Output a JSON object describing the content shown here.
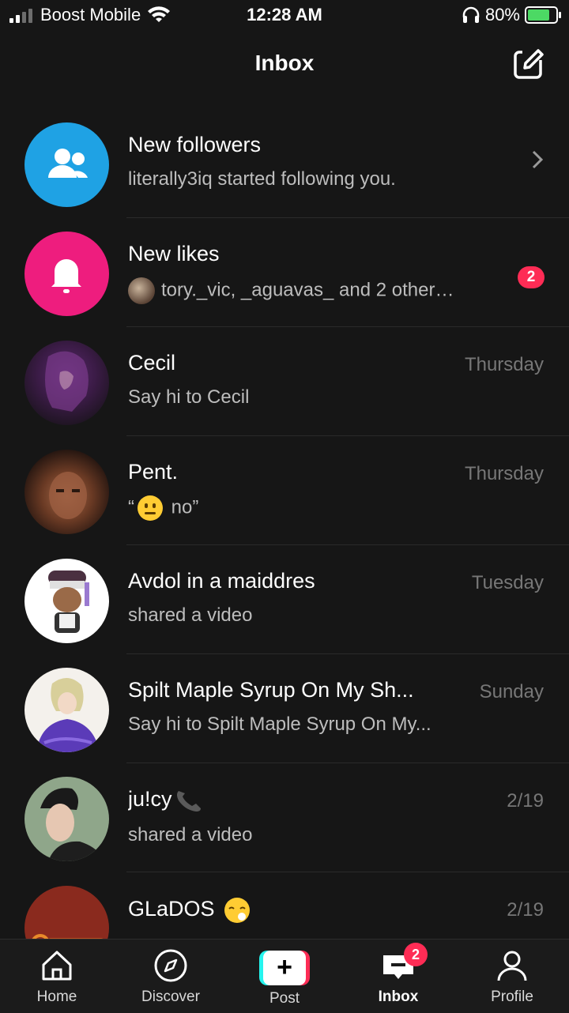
{
  "status_bar": {
    "carrier": "Boost Mobile",
    "time": "12:28 AM",
    "battery_percent": "80%",
    "battery_level": 0.8,
    "battery_color": "#4cd964"
  },
  "header": {
    "title": "Inbox",
    "compose_icon": "compose-icon"
  },
  "activity": [
    {
      "title": "New followers",
      "subtitle": "literally3iq started following you.",
      "icon": "followers-icon",
      "icon_bg": "#1fa2e4"
    },
    {
      "title": "New likes",
      "subtitle": "tory._vic, _aguavas_ and 2 others l...",
      "icon": "bell-icon",
      "icon_bg": "#ee1d7e",
      "badge": "2"
    }
  ],
  "conversations": [
    {
      "name": "Cecil",
      "message": "Say hi to Cecil",
      "time": "Thursday"
    },
    {
      "name": "Pent.",
      "message_prefix": "“",
      "message_suffix": " no”",
      "emoji": "neutral-face-emoji",
      "time": "Thursday"
    },
    {
      "name": "Avdol in a maiddres",
      "message": "shared a video",
      "time": "Tuesday"
    },
    {
      "name": "Spilt Maple Syrup On My Sh...",
      "message": "Say hi to Spilt Maple Syrup On My...",
      "time": "Sunday"
    },
    {
      "name": "ju!cy",
      "name_emoji": "telephone-emoji",
      "message": "shared a video",
      "time": "2/19"
    },
    {
      "name": "GLaDOS",
      "name_emoji": "face-emoji",
      "message": "",
      "time": "2/19"
    }
  ],
  "nav": {
    "home": "Home",
    "discover": "Discover",
    "post": "Post",
    "inbox": "Inbox",
    "inbox_badge": "2",
    "profile": "Profile"
  },
  "colors": {
    "accent": "#fe2c55",
    "cyan": "#25f4ee",
    "background": "#161616"
  }
}
